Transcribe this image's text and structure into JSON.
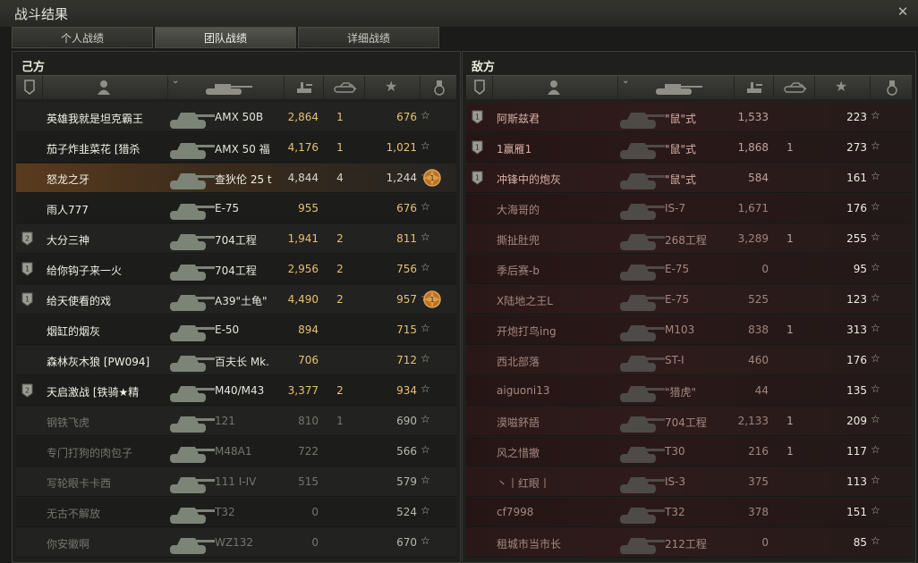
{
  "window": {
    "title": "战斗结果",
    "close_icon": "close-icon"
  },
  "tabs": [
    {
      "label": "个人战绩",
      "active": false
    },
    {
      "label": "团队战绩",
      "active": true
    },
    {
      "label": "详细战绩",
      "active": false
    }
  ],
  "ally": {
    "title": "己方",
    "rows": [
      {
        "badge": "",
        "name": "英雄我就是坦克霸王",
        "vehicle": "AMX 50B",
        "damage": "2,864",
        "kills": "1",
        "xp": "676",
        "medal": "",
        "state": "alive"
      },
      {
        "badge": "",
        "name": "茄子炸韭菜花 [猎杀",
        "vehicle": "AMX 50 福",
        "damage": "4,176",
        "kills": "1",
        "xp": "1,021",
        "medal": "",
        "state": "alive"
      },
      {
        "badge": "",
        "name": "怒龙之牙",
        "vehicle": "查狄伦 25 t",
        "damage": "4,844",
        "kills": "4",
        "xp": "1,244",
        "medal": "medal-icon",
        "state": "player"
      },
      {
        "badge": "",
        "name": "雨人777",
        "vehicle": "E-75",
        "damage": "955",
        "kills": "",
        "xp": "676",
        "medal": "",
        "state": "alive"
      },
      {
        "badge": "2",
        "name": "大分三神",
        "vehicle": "704工程",
        "damage": "1,941",
        "kills": "2",
        "xp": "811",
        "medal": "",
        "state": "alive"
      },
      {
        "badge": "1",
        "name": "给你钩子来一火",
        "vehicle": "704工程",
        "damage": "2,956",
        "kills": "2",
        "xp": "756",
        "medal": "",
        "state": "alive"
      },
      {
        "badge": "1",
        "name": "给天使看的戏",
        "vehicle": "A39\"土龟\"",
        "damage": "4,490",
        "kills": "2",
        "xp": "957",
        "medal": "medal-icon",
        "state": "alive"
      },
      {
        "badge": "",
        "name": "烟缸的烟灰",
        "vehicle": "E-50",
        "damage": "894",
        "kills": "",
        "xp": "715",
        "medal": "",
        "state": "alive"
      },
      {
        "badge": "",
        "name": "森林灰木狼 [PW094]",
        "vehicle": "百夫长 Mk.",
        "damage": "706",
        "kills": "",
        "xp": "712",
        "medal": "",
        "state": "alive"
      },
      {
        "badge": "2",
        "name": "天启激战 [铁骑★精",
        "vehicle": "M40/M43",
        "damage": "3,377",
        "kills": "2",
        "xp": "934",
        "medal": "",
        "state": "alive"
      },
      {
        "badge": "",
        "name": "钢铁飞虎",
        "vehicle": "121",
        "damage": "810",
        "kills": "1",
        "xp": "690",
        "medal": "",
        "state": "dead"
      },
      {
        "badge": "",
        "name": "专门打狗的肉包子",
        "vehicle": "M48A1",
        "damage": "722",
        "kills": "",
        "xp": "566",
        "medal": "",
        "state": "dead"
      },
      {
        "badge": "",
        "name": "写轮眼卡卡西",
        "vehicle": "111 I-IV",
        "damage": "515",
        "kills": "",
        "xp": "579",
        "medal": "",
        "state": "dead"
      },
      {
        "badge": "",
        "name": "无古不解放",
        "vehicle": "T32",
        "damage": "0",
        "kills": "",
        "xp": "524",
        "medal": "",
        "state": "dead"
      },
      {
        "badge": "",
        "name": "你安徽啊",
        "vehicle": "WZ132",
        "damage": "0",
        "kills": "",
        "xp": "670",
        "medal": "",
        "state": "dead"
      }
    ]
  },
  "enemy": {
    "title": "敌方",
    "rows": [
      {
        "badge": "1",
        "name": "阿斯兹君",
        "vehicle": "\"鼠\"式",
        "damage": "1,533",
        "kills": "",
        "xp": "223",
        "state": "alive"
      },
      {
        "badge": "1",
        "name": "1赢雁1",
        "vehicle": "\"鼠\"式",
        "damage": "1,868",
        "kills": "1",
        "xp": "273",
        "state": "alive"
      },
      {
        "badge": "1",
        "name": "冲锋中的炮灰",
        "vehicle": "\"鼠\"式",
        "damage": "584",
        "kills": "",
        "xp": "161",
        "state": "alive"
      },
      {
        "badge": "",
        "name": "大海哥的",
        "vehicle": "IS-7",
        "damage": "1,671",
        "kills": "",
        "xp": "176",
        "state": "dead"
      },
      {
        "badge": "",
        "name": "撕扯肚兜",
        "vehicle": "268工程",
        "damage": "3,289",
        "kills": "1",
        "xp": "255",
        "state": "dead"
      },
      {
        "badge": "",
        "name": "季后赛-b",
        "vehicle": "E-75",
        "damage": "0",
        "kills": "",
        "xp": "95",
        "state": "dead"
      },
      {
        "badge": "",
        "name": "X陆地之王L",
        "vehicle": "E-75",
        "damage": "525",
        "kills": "",
        "xp": "123",
        "state": "dead"
      },
      {
        "badge": "",
        "name": "开炮打鸟ing",
        "vehicle": "M103",
        "damage": "838",
        "kills": "1",
        "xp": "313",
        "state": "dead"
      },
      {
        "badge": "",
        "name": "西北部落",
        "vehicle": "ST-I",
        "damage": "460",
        "kills": "",
        "xp": "176",
        "state": "dead"
      },
      {
        "badge": "",
        "name": "aiguoni13",
        "vehicle": "\"猎虎\"",
        "damage": "44",
        "kills": "",
        "xp": "135",
        "state": "dead"
      },
      {
        "badge": "",
        "name": "漠嗞鈈語",
        "vehicle": "704工程",
        "damage": "2,133",
        "kills": "1",
        "xp": "209",
        "state": "dead"
      },
      {
        "badge": "",
        "name": "风之惜撤",
        "vehicle": "T30",
        "damage": "216",
        "kills": "1",
        "xp": "117",
        "state": "dead"
      },
      {
        "badge": "",
        "name": "丶丨红眼丨",
        "vehicle": "IS-3",
        "damage": "375",
        "kills": "",
        "xp": "113",
        "state": "dead"
      },
      {
        "badge": "",
        "name": "cf7998",
        "vehicle": "T32",
        "damage": "378",
        "kills": "",
        "xp": "151",
        "state": "dead"
      },
      {
        "badge": "",
        "name": "租城市当市长",
        "vehicle": "212工程",
        "damage": "0",
        "kills": "",
        "xp": "85",
        "state": "dead"
      }
    ]
  },
  "columns": {
    "icons": [
      "badge-column-icon",
      "player-column-icon",
      "sort-chevron-icon",
      "tank-column-icon",
      "damage-column-icon",
      "kills-column-icon",
      "xp-column-icon",
      "medal-column-icon"
    ]
  },
  "icons": {
    "star": "☆",
    "close": "✕"
  },
  "colors": {
    "background": "#1b1b1a",
    "ally_highlight": "#5a3b1e",
    "enemy_tint": "#2f1b1b",
    "damage_gold": "#e8c070"
  }
}
